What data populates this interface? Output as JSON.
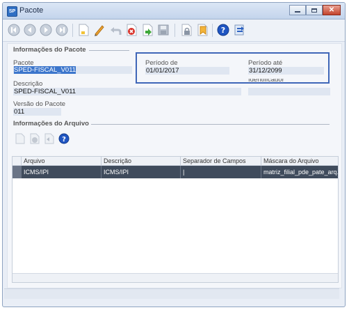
{
  "window": {
    "title": "Pacote"
  },
  "toolbar": {
    "icons": [
      "first-record-icon",
      "previous-record-icon",
      "next-record-icon",
      "last-record-icon",
      "new-document-icon",
      "edit-pencil-icon",
      "undo-icon",
      "delete-icon",
      "confirm-icon",
      "save-disk-icon",
      "lock-icon",
      "pin-icon",
      "help-icon",
      "exit-icon"
    ]
  },
  "section_pacote": {
    "title": "Informações do Pacote",
    "pacote_label": "Pacote",
    "pacote_value": "SPED-FISCAL_V011",
    "periodo_de_label": "Período de",
    "periodo_de_value": "01/01/2017",
    "periodo_ate_label": "Período até",
    "periodo_ate_value": "31/12/2099",
    "descricao_label": "Descrição",
    "descricao_value": "SPED-FISCAL_V011",
    "identificador_label": "Identificador",
    "versao_label": "Versão do Pacote",
    "versao_value": "011"
  },
  "section_arquivo": {
    "title": "Informações do Arquivo",
    "columns": [
      "Arquivo",
      "Descrição",
      "Separador de Campos",
      "Máscara do Arquivo"
    ],
    "rows": [
      {
        "arquivo": "ICMS/IPI",
        "descricao": "ICMS/IPI",
        "separador": "|",
        "mascara": "matriz_filial_pde_pate_arq..."
      }
    ]
  },
  "colors": {
    "accent": "#3f66b8",
    "selected_row": "#3f4b5c",
    "selection": "#3c76cc"
  }
}
